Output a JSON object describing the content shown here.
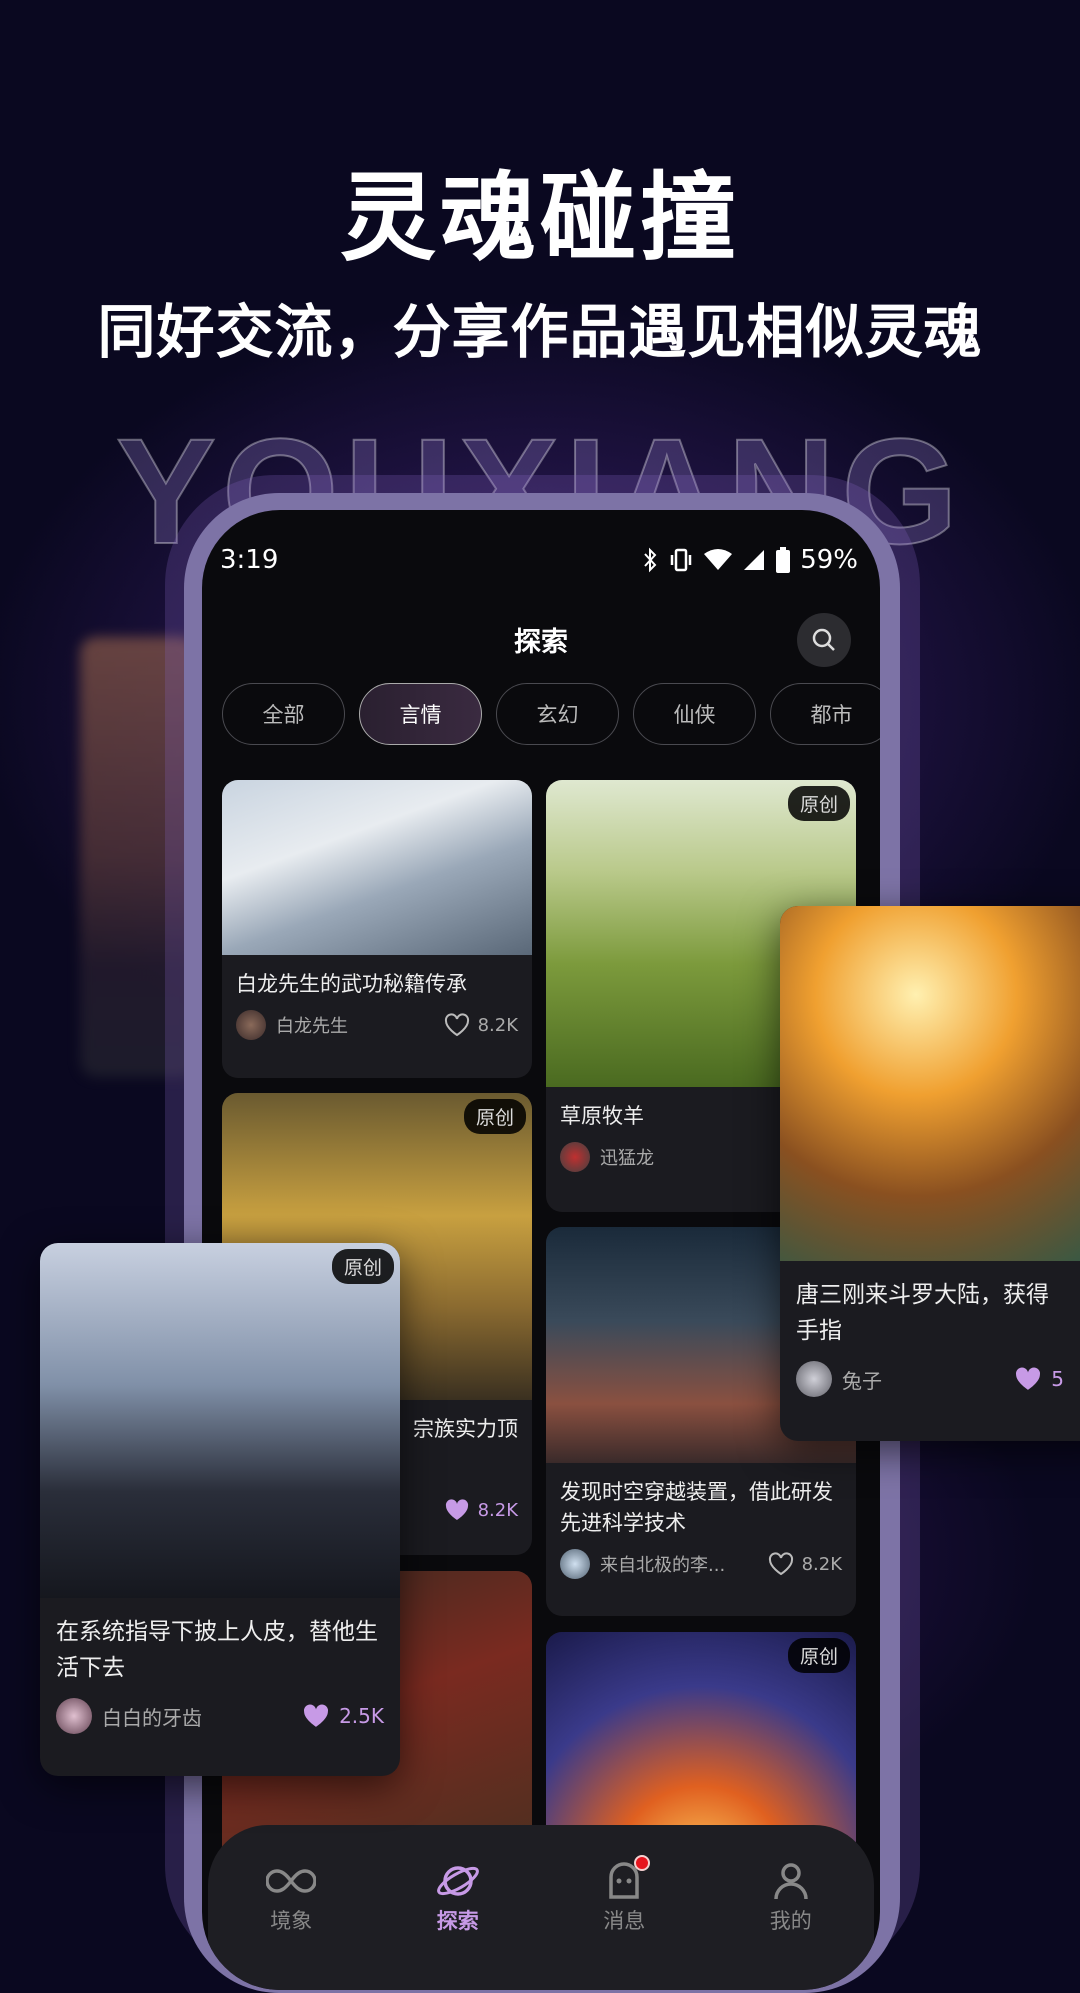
{
  "promo": {
    "headline": "灵魂碰撞",
    "subheadline": "同好交流，分享作品遇见相似灵魂",
    "brand_watermark": "YOUXIANG"
  },
  "status_bar": {
    "time": "3:19",
    "battery": "59%",
    "icons": [
      "bluetooth-icon",
      "vibrate-icon",
      "wifi-icon",
      "signal-icon",
      "battery-icon"
    ]
  },
  "header": {
    "title": "探索",
    "search_icon": "search-icon"
  },
  "categories": [
    {
      "label": "全部"
    },
    {
      "label": "言情",
      "active": true
    },
    {
      "label": "玄幻"
    },
    {
      "label": "仙侠"
    },
    {
      "label": "都市"
    }
  ],
  "feed": [
    {
      "title": "白龙先生的武功秘籍传承",
      "author": "白龙先生",
      "likes": "8.2K",
      "liked": false
    },
    {
      "title": "草原牧羊",
      "author": "迅猛龙",
      "badge": "原创",
      "liked": true
    },
    {
      "title": "宗族实力顶",
      "likes": "8.2K",
      "badge": "原创",
      "liked": true
    },
    {
      "title": "发现时空穿越装置，借此研发先进科学技术",
      "author": "来自北极的李...",
      "likes": "8.2K",
      "liked": false
    },
    {
      "title": ""
    },
    {
      "badge": "原创"
    }
  ],
  "floating_cards": [
    {
      "title": "在系统指导下披上人皮，替他生活下去",
      "author": "白白的牙齿",
      "likes": "2.5K",
      "badge": "原创",
      "liked": true
    },
    {
      "title": "唐三刚来斗罗大陆，获得手指",
      "author": "兔子",
      "likes": "5",
      "liked": true
    }
  ],
  "bottom_nav": [
    {
      "label": "境象",
      "icon": "infinity-icon"
    },
    {
      "label": "探索",
      "icon": "planet-icon",
      "active": true
    },
    {
      "label": "消息",
      "icon": "chat-icon",
      "badge": true
    },
    {
      "label": "我的",
      "icon": "profile-icon"
    }
  ],
  "colors": {
    "accent": "#c79ae6",
    "background": "#0a0820",
    "card": "#1b1b20",
    "notification": "#e5141e"
  }
}
